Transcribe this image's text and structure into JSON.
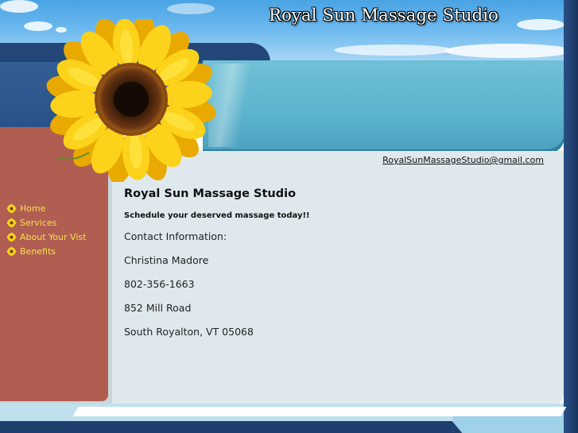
{
  "header": {
    "site_title": "Royal Sun Massage Studio"
  },
  "contact_link": {
    "email": "RoyalSunMassageStudio@gmail.com"
  },
  "nav": {
    "items": [
      {
        "label": "Home"
      },
      {
        "label": "Services"
      },
      {
        "label": "About Your Vist"
      },
      {
        "label": "Benefits"
      }
    ]
  },
  "main": {
    "heading": "Royal Sun Massage Studio",
    "tagline": "Schedule your deserved massage today!!",
    "contact_heading": "Contact Information:",
    "name": "Christina Madore",
    "phone": "802-356-1663",
    "address": "852 Mill Road",
    "city_state_zip": "South Royalton, VT 05068"
  },
  "colors": {
    "sky": "#6ab8ee",
    "navy": "#24477a",
    "banner_turquoise": "#5cb3cc",
    "sidebar_brick": "#b05e51",
    "nav_text": "#f5e04a",
    "panel": "#dfe8ec",
    "petal": "#f7d31c"
  },
  "icons": {
    "nav_bullet": "small-sunflower-icon",
    "hero": "sunflower-image"
  }
}
